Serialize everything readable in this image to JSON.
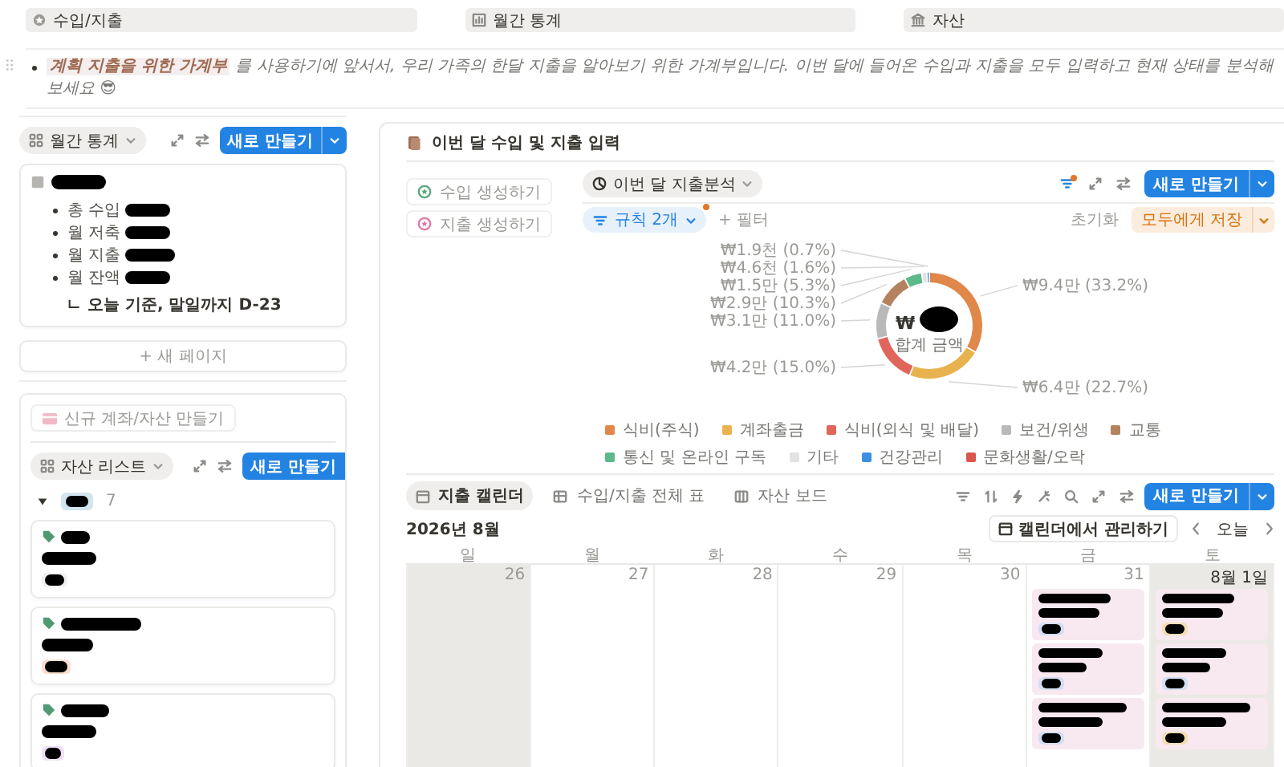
{
  "header_tiles": [
    {
      "kind": "badge",
      "label": "수입/지출"
    },
    {
      "kind": "chart",
      "label": "월간 통계"
    },
    {
      "kind": "bank",
      "label": "자산"
    }
  ],
  "intro": {
    "highlight": "계획 지출을 위한 가계부",
    "text": "를 사용하기에 앞서서, 우리 가족의 한달 지출을 알아보기 위한 가계부입니다. 이번 달에 들어온 수입과 지출을 모두 입력하고 현재 상태를 분석해보세요 😎"
  },
  "monthly": {
    "view": "월간 통계",
    "new_button": "새로 만들기",
    "stats": [
      {
        "label": "총 수입"
      },
      {
        "label": "월 저축"
      },
      {
        "label": "월 지출"
      },
      {
        "label": "월 잔액"
      }
    ],
    "note": "ㄴ 오늘 기준, 말일까지 D-23",
    "new_page": "+ 새 페이지"
  },
  "assets": {
    "create_button": "신규 계좌/자산 만들기",
    "view": "자산 리스트",
    "new_button": "새로 만들기",
    "group": {
      "expanded": true,
      "count": "7"
    },
    "cards": [
      {
        "color": "#f1f1ef"
      },
      {
        "color": "#fadfd0"
      },
      {
        "color": "#efe0f7"
      }
    ]
  },
  "entry": {
    "title": "이번 달 수입 및 지출 입력",
    "actions": [
      {
        "label": "수입 생성하기",
        "color": "#5ba87a"
      },
      {
        "label": "지출 생성하기",
        "color": "#e07aa8"
      }
    ],
    "analysis": {
      "view": "이번 달 지출분석",
      "new_button": "새로 만들기",
      "filter_chip": "규칙 2개",
      "add_filter": "+ 필터",
      "reset": "초기화",
      "save": "모두에게 저장",
      "center_currency": "₩",
      "center_label": "합계 금액",
      "chart_data": {
        "type": "donut",
        "categories": [
          "식비(주식)",
          "계좌출금",
          "식비(외식 및 배달)",
          "보건/위생",
          "교통",
          "통신 및 온라인 구독",
          "기타",
          "건강관리",
          "문화생활/오락"
        ],
        "values": [
          33.2,
          22.7,
          15.0,
          11.0,
          10.3,
          5.3,
          1.6,
          0.7,
          null
        ],
        "value_labels": [
          "₩9.4만 (33.2%)",
          "₩6.4만 (22.7%)",
          "₩4.2만 (15.0%)",
          "₩3.1만 (11.0%)",
          "₩2.9만 (10.3%)",
          "₩1.5만 (5.3%)",
          "₩4.6천 (1.6%)",
          "₩1.9천 (0.7%)",
          null
        ]
      },
      "legend": [
        {
          "color": "#e0874a"
        },
        {
          "color": "#e8b34f"
        },
        {
          "color": "#e0655a"
        },
        {
          "color": "#b9b9b9"
        },
        {
          "color": "#b5825f"
        },
        {
          "color": "#5cb98a"
        },
        {
          "color": "#e3e3e3"
        },
        {
          "color": "#3f8fe0"
        },
        {
          "color": "#d9574d"
        }
      ]
    }
  },
  "database": {
    "tabs": [
      {
        "kind": "calendar",
        "label": "지출 캘린더",
        "selected": true
      },
      {
        "kind": "table",
        "label": "수입/지출 전체 표",
        "selected": false
      },
      {
        "kind": "board",
        "label": "자산 보드",
        "selected": false
      }
    ],
    "new_button": "새로 만들기",
    "month": "2026년 8월",
    "manage_button": "캘린더에서 관리하기",
    "today": "오늘",
    "weekdays": [
      "일",
      "월",
      "화",
      "수",
      "목",
      "금",
      "토"
    ],
    "days": [
      {
        "label": "26",
        "weekend": true,
        "current_month": false
      },
      {
        "label": "27",
        "weekend": false,
        "current_month": false
      },
      {
        "label": "28",
        "weekend": false,
        "current_month": false
      },
      {
        "label": "29",
        "weekend": false,
        "current_month": false
      },
      {
        "label": "30",
        "weekend": false,
        "current_month": false
      },
      {
        "label": "31",
        "weekend": false,
        "current_month": false,
        "events": [
          {
            "color": "#d3def3"
          },
          {
            "color": "#d3def3"
          },
          {
            "color": "#d3def3"
          }
        ]
      },
      {
        "label": "8월 1일",
        "weekend": true,
        "current_month": true,
        "events": [
          {
            "color": "#f6dcb4"
          },
          {
            "color": "#d3def3"
          },
          {
            "color": "#f6dcb4"
          }
        ]
      }
    ]
  }
}
